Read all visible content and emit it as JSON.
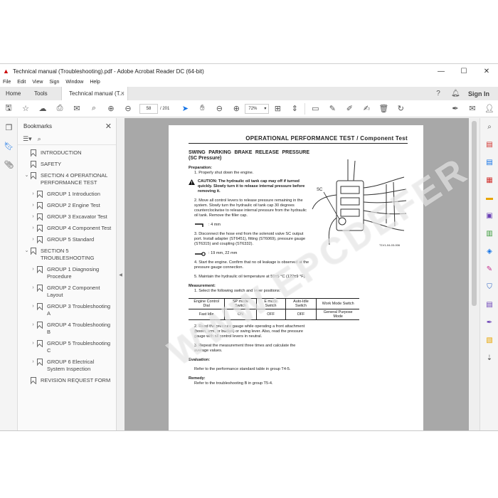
{
  "window": {
    "title": "Technical manual (Troubleshooting).pdf - Adobe Acrobat Reader DC (64-bit)",
    "minimize_glyph": "—",
    "maximize_glyph": "☐",
    "close_glyph": "✕"
  },
  "menu": [
    "File",
    "Edit",
    "View",
    "Sign",
    "Window",
    "Help"
  ],
  "tabs": {
    "home": "Home",
    "tools": "Tools",
    "document": "Technical manual (T...",
    "close": "×",
    "sign_in": "Sign In"
  },
  "toolbar": {
    "current_page": "58",
    "total_pages": "/ 201",
    "zoom": "72%"
  },
  "bookmarks": {
    "title": "Bookmarks",
    "close": "✕",
    "items": [
      {
        "label": "INTRODUCTION",
        "level": 1
      },
      {
        "label": "SAFETY",
        "level": 1
      },
      {
        "label": "SECTION 4 OPERATIONAL PERFORMANCE TEST",
        "level": 1,
        "expanded": true
      },
      {
        "label": "GROUP 1 Introduction",
        "level": 2
      },
      {
        "label": "GROUP 2 Engine Test",
        "level": 2
      },
      {
        "label": "GROUP 3 Excavator Test",
        "level": 2
      },
      {
        "label": "GROUP 4 Component Test",
        "level": 2
      },
      {
        "label": "GROUP 5 Standard",
        "level": 2
      },
      {
        "label": "SECTION 5 TROUBLESHOOTING",
        "level": 1,
        "expanded": true
      },
      {
        "label": "GROUP 1 Diagnosing Procedure",
        "level": 2
      },
      {
        "label": "GROUP 2 Component Layout",
        "level": 2
      },
      {
        "label": "GROUP 3 Troubleshooting A",
        "level": 2
      },
      {
        "label": "GROUP 4 Troubleshooting B",
        "level": 2
      },
      {
        "label": "GROUP 5 Troubleshooting C",
        "level": 2
      },
      {
        "label": "GROUP 6 Electrical System Inspection",
        "level": 2
      },
      {
        "label": "REVISION REQUEST FORM",
        "level": 1
      }
    ]
  },
  "doc": {
    "header": "OPERATIONAL PERFORMANCE TEST / Component Test",
    "section_title": "SWING PARKING BRAKE RELEASE PRESSURE (SC Pressure)",
    "preparation": "Preparation:",
    "step1": "1.  Properly shut down the engine.",
    "caution": "CAUTION:  The hydraulic oil tank cap may off if turned quickly. Slowly turn it to release internal pressure before removing it.",
    "step2": "2.  Move all control levers to release pressure remaining in the system. Slowly turn the hydraulic oil tank cap 30 degrees counterclockwise to release internal pressure from the hydraulic oil tank. Remove the filler cap.",
    "tool1": ": 4 mm",
    "step3": "3.  Disconnect the hose end from the solenoid valve SC output port. Install adapter (ST6451), fitting (ST6069), pressure gauge (ST6315) and coupling (ST6332).",
    "tool2": ": 19 mm, 22 mm",
    "step4": "4.  Start the engine. Confirm that no oil leakage is observed at the pressure gauge connection.",
    "step5": "5.  Maintain the hydraulic oil temperature at 50±5 °C (122±9 °F).",
    "measurement": "Measurement:",
    "mstep1": "1.  Select the following switch and lever positions:",
    "table_header": [
      "Engine Control Dial",
      "SP mode Switch",
      "E mode Switch",
      "Auto-Idle Switch",
      "Work Mode Switch"
    ],
    "table_row": [
      "Fast Idle",
      "ON",
      "OFF",
      "OFF",
      "General Purpose Mode"
    ],
    "mstep2": "2.  Read the pressure gauge while operating a front attachment (boom, arm, or bucket) or swing lever. Also, read the pressure gauge with all control levers in neutral.",
    "mstep3": "3.  Repeat the measurement three times and calculate the average values.",
    "evaluation": "Evaluation:",
    "eval_text": "Refer to the performance standard table in group T4-5.",
    "remedy": "Remedy:",
    "remedy_text": "Refer to the troubleshooting B in group T5-4.",
    "diagram_label": "SC",
    "diagram_code": "T1V1-04-03-006"
  },
  "watermark": "WWW.EPCDEFER.COM",
  "colors": {
    "accent": "#1473e6",
    "pdf_red": "#cc0000"
  }
}
